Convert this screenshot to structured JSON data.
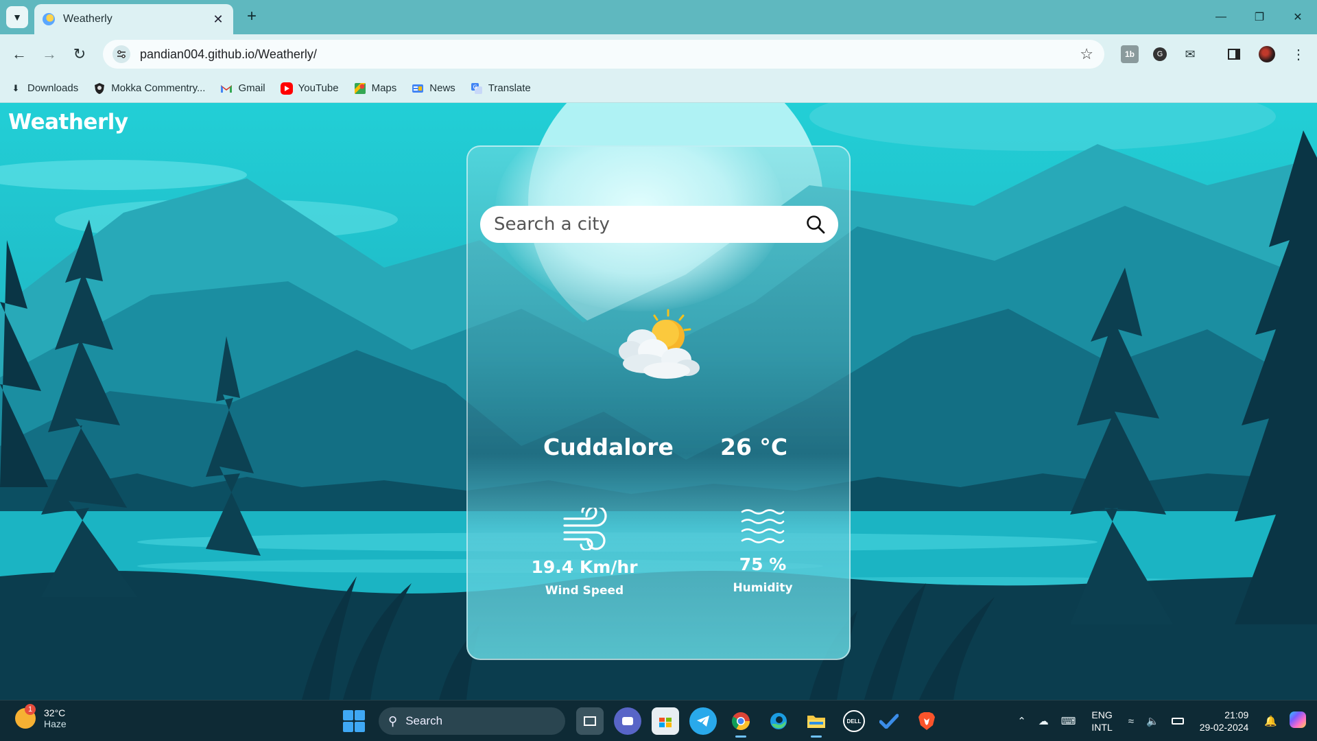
{
  "browser": {
    "tab": {
      "title": "Weatherly"
    },
    "omnibox": {
      "url": "pandian004.github.io/Weatherly/"
    },
    "bookmarks": [
      {
        "label": "Downloads",
        "icon": "download-icon"
      },
      {
        "label": "Mokka Commentry...",
        "icon": "shield-icon"
      },
      {
        "label": "Gmail",
        "icon": "gmail-icon"
      },
      {
        "label": "YouTube",
        "icon": "youtube-icon"
      },
      {
        "label": "Maps",
        "icon": "maps-icon"
      },
      {
        "label": "News",
        "icon": "news-icon"
      },
      {
        "label": "Translate",
        "icon": "translate-icon"
      }
    ]
  },
  "app": {
    "brand": "Weatherly",
    "search": {
      "placeholder": "Search a city",
      "value": ""
    },
    "weather": {
      "city": "Cuddalore",
      "temperature": "26 °C",
      "condition_icon": "partly-cloudy-icon",
      "wind": {
        "value": "19.4 Km/hr",
        "label": "Wind Speed"
      },
      "humidity": {
        "value": "75 %",
        "label": "Humidity"
      }
    }
  },
  "taskbar": {
    "weather": {
      "temp": "32°C",
      "condition": "Haze",
      "badge": "1"
    },
    "search_label": "Search",
    "language": {
      "line1": "ENG",
      "line2": "INTL"
    },
    "clock": {
      "time": "21:09",
      "date": "29-02-2024"
    }
  },
  "colors": {
    "accent": "#22cfd6",
    "chrome": "#ddf1f3",
    "taskbar": "#0e2a35"
  }
}
